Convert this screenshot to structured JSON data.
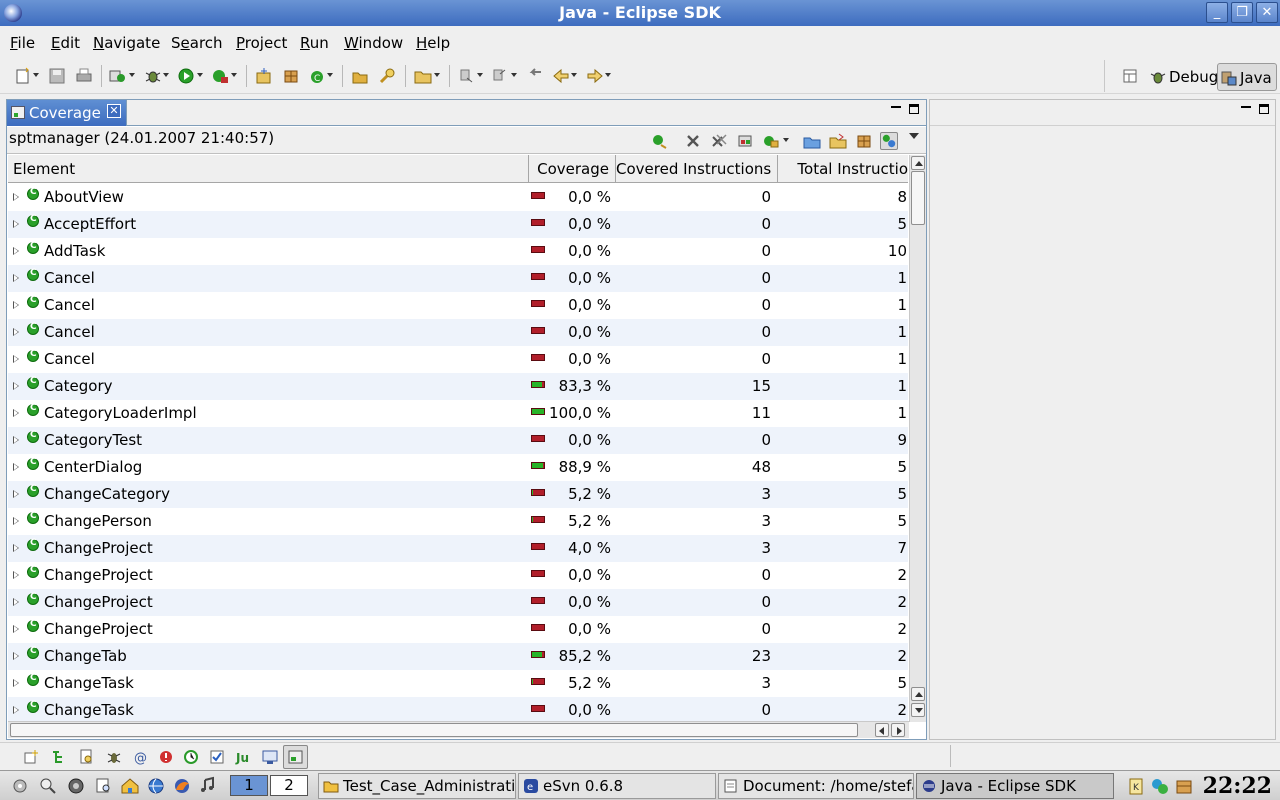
{
  "window": {
    "title": "Java - Eclipse SDK"
  },
  "menu": [
    {
      "label": "File",
      "mnemonic": "F",
      "rest": "ile"
    },
    {
      "label": "Edit",
      "mnemonic": "E",
      "rest": "dit"
    },
    {
      "label": "Navigate",
      "mnemonic": "N",
      "rest": "avigate"
    },
    {
      "label": "Search",
      "pre": "S",
      "mnemonic": "e",
      "rest": "arch"
    },
    {
      "label": "Project",
      "mnemonic": "P",
      "rest": "roject"
    },
    {
      "label": "Run",
      "mnemonic": "R",
      "rest": "un"
    },
    {
      "label": "Window",
      "mnemonic": "W",
      "rest": "indow"
    },
    {
      "label": "Help",
      "mnemonic": "H",
      "rest": "elp"
    }
  ],
  "perspectives": {
    "debug": "Debug",
    "java": "Java"
  },
  "coverage": {
    "tab_label": "Coverage",
    "session": "sptmanager (24.01.2007 21:40:57)",
    "columns": {
      "element": "Element",
      "coverage": "Coverage",
      "covered": "Covered Instructions",
      "total": "Total Instructio"
    },
    "rows": [
      {
        "name": "AboutView",
        "coverage": "0,0 %",
        "fraction": 0.0,
        "covered": "0",
        "total": "8"
      },
      {
        "name": "AcceptEffort",
        "coverage": "0,0 %",
        "fraction": 0.0,
        "covered": "0",
        "total": "5"
      },
      {
        "name": "AddTask",
        "coverage": "0,0 %",
        "fraction": 0.0,
        "covered": "0",
        "total": "10"
      },
      {
        "name": "Cancel",
        "coverage": "0,0 %",
        "fraction": 0.0,
        "covered": "0",
        "total": "1"
      },
      {
        "name": "Cancel",
        "coverage": "0,0 %",
        "fraction": 0.0,
        "covered": "0",
        "total": "1"
      },
      {
        "name": "Cancel",
        "coverage": "0,0 %",
        "fraction": 0.0,
        "covered": "0",
        "total": "1"
      },
      {
        "name": "Cancel",
        "coverage": "0,0 %",
        "fraction": 0.0,
        "covered": "0",
        "total": "1"
      },
      {
        "name": "Category",
        "coverage": "83,3 %",
        "fraction": 0.833,
        "covered": "15",
        "total": "1"
      },
      {
        "name": "CategoryLoaderImpl",
        "coverage": "100,0 %",
        "fraction": 1.0,
        "covered": "11",
        "total": "1"
      },
      {
        "name": "CategoryTest",
        "coverage": "0,0 %",
        "fraction": 0.0,
        "covered": "0",
        "total": "9"
      },
      {
        "name": "CenterDialog",
        "coverage": "88,9 %",
        "fraction": 0.889,
        "covered": "48",
        "total": "5"
      },
      {
        "name": "ChangeCategory",
        "coverage": "5,2 %",
        "fraction": 0.052,
        "covered": "3",
        "total": "5"
      },
      {
        "name": "ChangePerson",
        "coverage": "5,2 %",
        "fraction": 0.052,
        "covered": "3",
        "total": "5"
      },
      {
        "name": "ChangeProject",
        "coverage": "4,0 %",
        "fraction": 0.04,
        "covered": "3",
        "total": "7"
      },
      {
        "name": "ChangeProject",
        "coverage": "0,0 %",
        "fraction": 0.0,
        "covered": "0",
        "total": "2"
      },
      {
        "name": "ChangeProject",
        "coverage": "0,0 %",
        "fraction": 0.0,
        "covered": "0",
        "total": "2"
      },
      {
        "name": "ChangeProject",
        "coverage": "0,0 %",
        "fraction": 0.0,
        "covered": "0",
        "total": "2"
      },
      {
        "name": "ChangeTab",
        "coverage": "85,2 %",
        "fraction": 0.852,
        "covered": "23",
        "total": "2"
      },
      {
        "name": "ChangeTask",
        "coverage": "5,2 %",
        "fraction": 0.052,
        "covered": "3",
        "total": "5"
      },
      {
        "name": "ChangeTask",
        "coverage": "0,0 %",
        "fraction": 0.0,
        "covered": "0",
        "total": "2"
      }
    ]
  },
  "taskbar": {
    "desktops": [
      "1",
      "2"
    ],
    "tasks": [
      {
        "label": "Test_Case_Administration"
      },
      {
        "label": "eSvn 0.6.8"
      },
      {
        "label": "Document: /home/stefan/s"
      },
      {
        "label": "Java - Eclipse SDK"
      }
    ],
    "clock": "22:22"
  },
  "colors": {
    "covered": "#28b428",
    "missed": "#b11e2a",
    "accent": "#3d6cbf"
  }
}
